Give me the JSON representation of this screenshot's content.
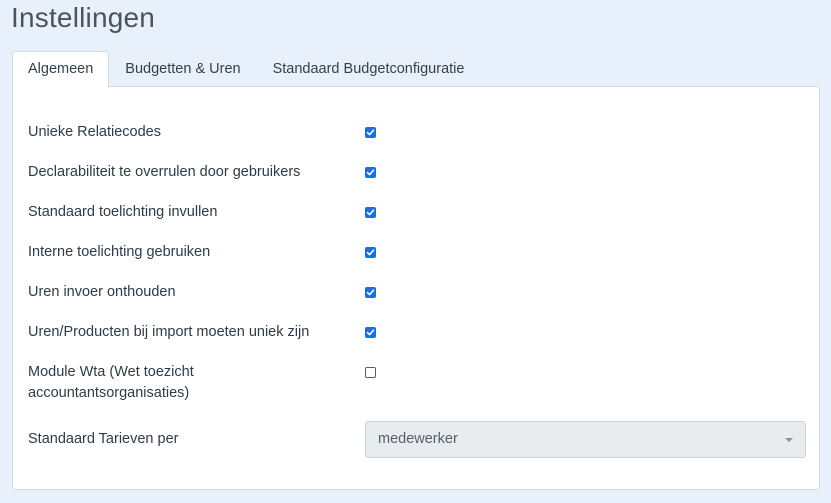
{
  "page": {
    "title": "Instellingen"
  },
  "tabs": [
    {
      "label": "Algemeen",
      "active": true
    },
    {
      "label": "Budgetten & Uren",
      "active": false
    },
    {
      "label": "Standaard Budgetconfiguratie",
      "active": false
    }
  ],
  "settings": [
    {
      "label": "Unieke Relatiecodes",
      "checked": true
    },
    {
      "label": "Declarabiliteit te overrulen door gebruikers",
      "checked": true
    },
    {
      "label": "Standaard toelichting invullen",
      "checked": true
    },
    {
      "label": "Interne toelichting gebruiken",
      "checked": true
    },
    {
      "label": "Uren invoer onthouden",
      "checked": true
    },
    {
      "label": "Uren/Producten bij import moeten uniek zijn",
      "checked": true
    },
    {
      "label": "Module Wta (Wet toezicht accountantsorganisaties)",
      "checked": false
    }
  ],
  "rate_setting": {
    "label": "Standaard Tarieven per",
    "selected": "medewerker"
  },
  "colors": {
    "accent": "#1a6fe0",
    "background": "#e8f1fb"
  }
}
